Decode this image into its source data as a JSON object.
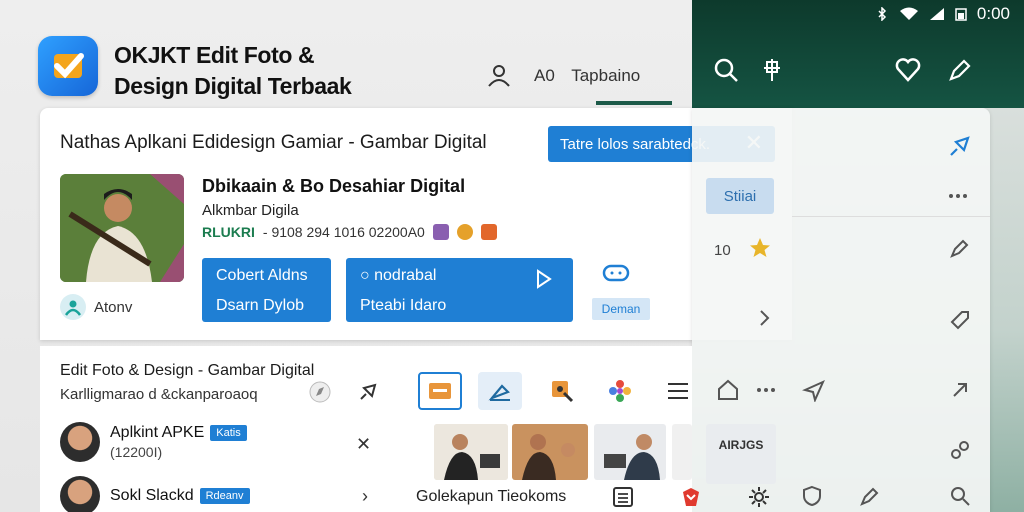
{
  "status_bar": {
    "time": "0:00"
  },
  "app": {
    "title_line1": "OKJKT Edit Foto &",
    "title_line2": "Design Digital Terbaak"
  },
  "header": {
    "tab_prefix": "A0",
    "tab_label": "Tapbaino"
  },
  "card": {
    "title": "Nathas Aplkani  Edidesign Gamiar - Gambar Digital",
    "tag_label": "Tatre lolos sarabtedck.",
    "product_title": "Dbikaain & Bo Desahiar Digital",
    "product_sub": "Alkmbar Digila",
    "meta_tag": "RLUKRI",
    "meta_text": "- 9108 294 1016 02200A0",
    "btn1_line1": "Cobert Aldns",
    "btn1_line2": "Dsarn Dylob",
    "btn2_line1": "nodrabal",
    "btn2_line2": "Pteabi Idaro",
    "demo_badge": "Deman",
    "author_label": "Atonv"
  },
  "right_panel": {
    "pill_label": "Stiiai",
    "rating_count": "10",
    "news_label": "AIRJGS"
  },
  "lower": {
    "title": "Edit Foto & Design - Gambar Digital",
    "subtitle": "Karlligmarao d &ckanparoaoq",
    "items": [
      {
        "name": "Aplkint APKE",
        "badge": "Katis",
        "sub": "(12200I)"
      },
      {
        "name": "Sokl Slackd",
        "badge": "Rdeanv",
        "sub": ""
      }
    ],
    "bottom_label": "Golekapun Tieokoms"
  },
  "colors": {
    "accent": "#1f7fd4",
    "dark_green": "#0d3a2c",
    "tag_green": "#1b7c4f"
  },
  "icons": [
    "wifi-icon",
    "signal-icon",
    "battery-icon",
    "search-icon",
    "pin-icon",
    "heart-icon",
    "edit-icon",
    "user-icon",
    "close-icon",
    "play-icon",
    "chat-icon",
    "star-icon",
    "more-icon",
    "chevron-right-icon",
    "home-icon",
    "share-icon"
  ]
}
